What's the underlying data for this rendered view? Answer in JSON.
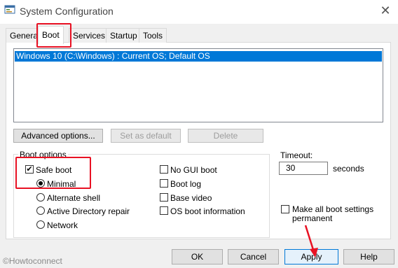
{
  "window": {
    "title": "System Configuration",
    "close_glyph": "✕",
    "icon": "system-config-icon"
  },
  "tabs": [
    {
      "label": "General",
      "selected": false
    },
    {
      "label": "Boot",
      "selected": true
    },
    {
      "label": "Services",
      "selected": false
    },
    {
      "label": "Startup",
      "selected": false
    },
    {
      "label": "Tools",
      "selected": false
    }
  ],
  "os_list": {
    "items": [
      "Windows 10 (C:\\Windows) : Current OS; Default OS"
    ],
    "selected_index": 0
  },
  "list_buttons": {
    "advanced": "Advanced options...",
    "set_default": "Set as default",
    "delete": "Delete"
  },
  "boot_options": {
    "group_label": "Boot options",
    "safe_boot": {
      "label": "Safe boot",
      "checked": true
    },
    "radios": [
      {
        "label": "Minimal",
        "selected": true
      },
      {
        "label": "Alternate shell",
        "selected": false
      },
      {
        "label": "Active Directory repair",
        "selected": false
      },
      {
        "label": "Network",
        "selected": false
      }
    ],
    "checkboxes": [
      {
        "label": "No GUI boot",
        "checked": false
      },
      {
        "label": "Boot log",
        "checked": false
      },
      {
        "label": "Base video",
        "checked": false
      },
      {
        "label": "OS boot information",
        "checked": false
      }
    ]
  },
  "timeout": {
    "label": "Timeout:",
    "value": "30",
    "unit": "seconds"
  },
  "make_permanent": {
    "label": "Make all boot settings permanent",
    "checked": false
  },
  "buttons": {
    "ok": "OK",
    "cancel": "Cancel",
    "apply": "Apply",
    "help": "Help"
  },
  "watermark": "©Howtoconnect",
  "colors": {
    "selection": "#0078d7",
    "annotation": "#e81123"
  }
}
